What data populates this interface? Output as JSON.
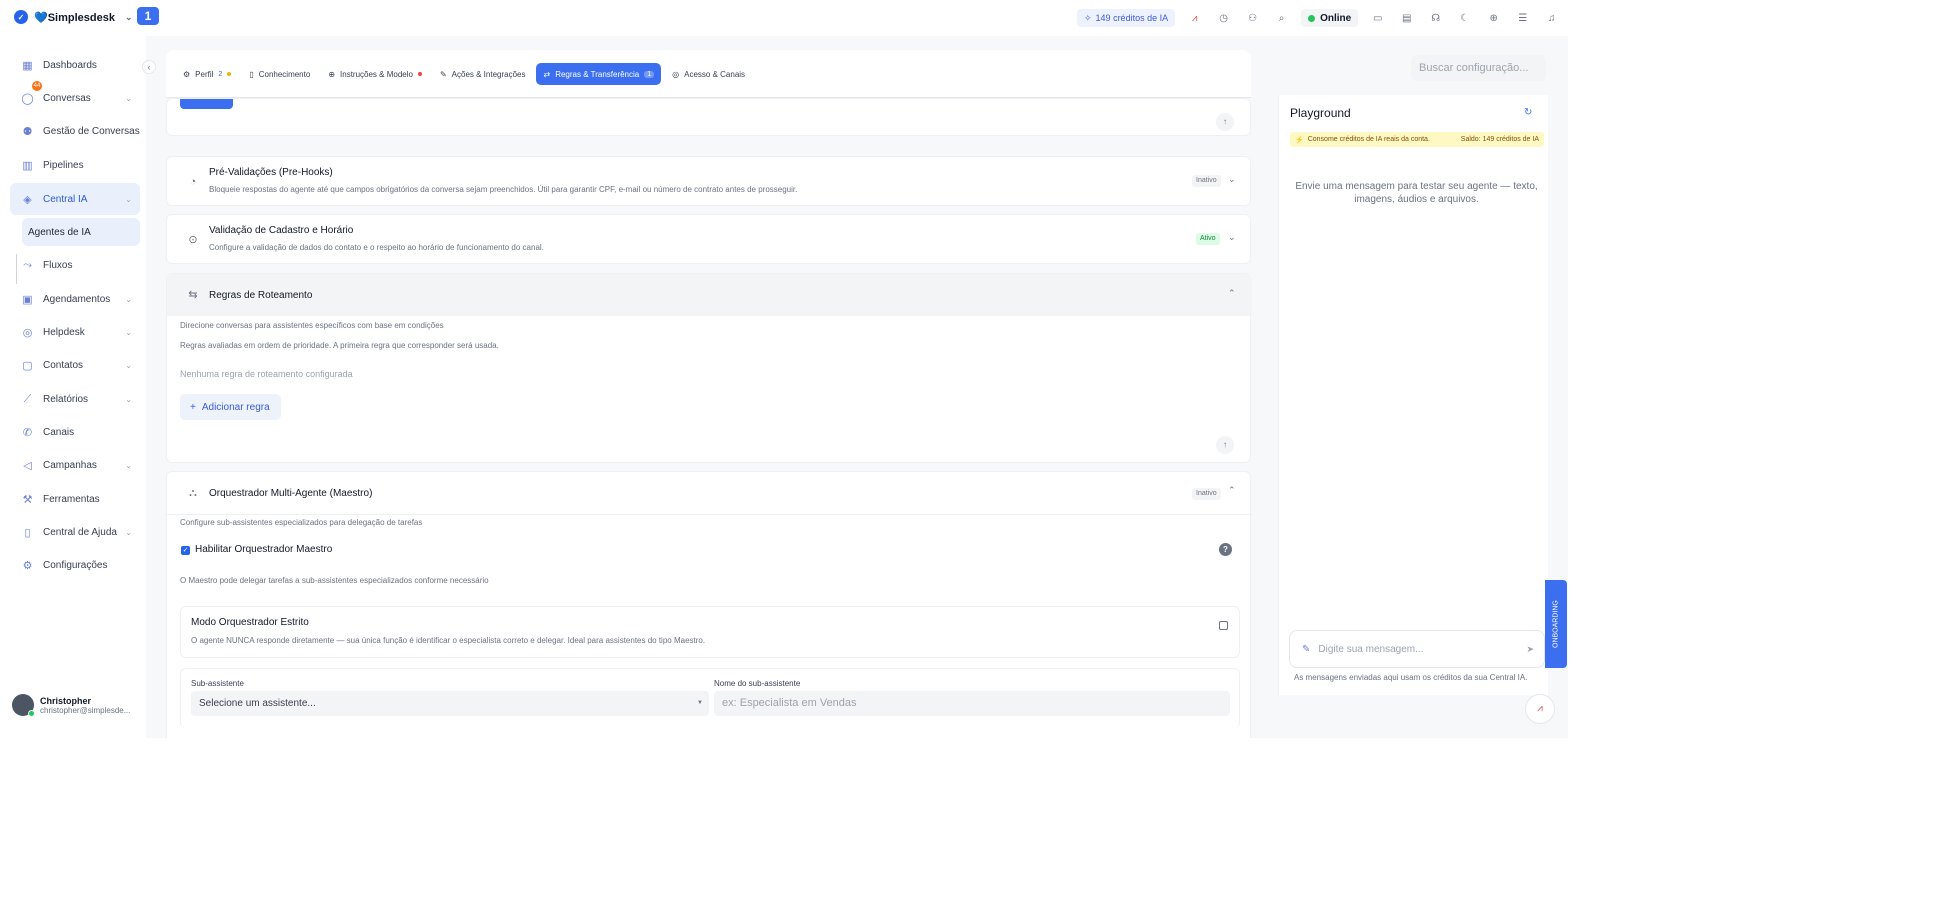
{
  "brand": {
    "name": "💙Simplesdesk",
    "tab_number": "1"
  },
  "topbar": {
    "credits": "149 créditos de IA",
    "status": "Online"
  },
  "sidebar": {
    "items": [
      {
        "label": "Dashboards",
        "icon": "grid-icon"
      },
      {
        "label": "Conversas",
        "icon": "chat-icon",
        "badge": "44"
      },
      {
        "label": "Gestão de Conversas",
        "icon": "people-chat-icon"
      },
      {
        "label": "Pipelines",
        "icon": "kanban-icon"
      },
      {
        "label": "Central IA",
        "icon": "ai-icon"
      },
      {
        "label": "Agentes de IA",
        "icon": ""
      },
      {
        "label": "Fluxos",
        "icon": "flow-icon"
      },
      {
        "label": "Agendamentos",
        "icon": "calendar-icon"
      },
      {
        "label": "Helpdesk",
        "icon": "lifebuoy-icon"
      },
      {
        "label": "Contatos",
        "icon": "contacts-icon"
      },
      {
        "label": "Relatórios",
        "icon": "chart-icon"
      },
      {
        "label": "Canais",
        "icon": "phone-icon"
      },
      {
        "label": "Campanhas",
        "icon": "megaphone-icon"
      },
      {
        "label": "Ferramentas",
        "icon": "tools-icon"
      },
      {
        "label": "Central de Ajuda",
        "icon": "book-icon"
      },
      {
        "label": "Configurações",
        "icon": "gear-icon"
      }
    ],
    "user": {
      "name": "Christopher",
      "email": "christopher@simplesde..."
    }
  },
  "tabs": [
    {
      "label": "Perfil",
      "count": "2"
    },
    {
      "label": "Conhecimento"
    },
    {
      "label": "Instruções & Modelo"
    },
    {
      "label": "Ações & Integrações"
    },
    {
      "label": "Regras & Transferência",
      "count": "1"
    },
    {
      "label": "Acesso & Canais"
    }
  ],
  "search": {
    "placeholder": "Buscar configuração..."
  },
  "sections": {
    "prehooks": {
      "title": "Pré-Validações (Pre-Hooks)",
      "desc": "Bloqueie respostas do agente até que campos obrigatórios da conversa sejam preenchidos. Útil para garantir CPF, e-mail ou número de contrato antes de prosseguir.",
      "state": "Inativo"
    },
    "validation": {
      "title": "Validação de Cadastro e Horário",
      "desc": "Configure a validação de dados do contato e o respeito ao horário de funcionamento do canal.",
      "state": "Ativo"
    },
    "routing": {
      "title": "Regras de Roteamento",
      "desc1": "Direcione conversas para assistentes específicos com base em condições",
      "desc2": "Regras avaliadas em ordem de prioridade. A primeira regra que corresponder será usada.",
      "empty": "Nenhuma regra de roteamento configurada",
      "add_button": "Adicionar regra"
    },
    "maestro": {
      "title": "Orquestrador Multi-Agente (Maestro)",
      "state": "Inativo",
      "desc": "Configure sub-assistentes especializados para delegação de tarefas",
      "enable_label": "Habilitar Orquestrador Maestro",
      "enable_help": "O Maestro pode delegar tarefas a sub-assistentes especializados conforme necessário",
      "strict_title": "Modo Orquestrador Estrito",
      "strict_desc": "O agente NUNCA responde diretamente — sua única função é identificar o especialista correto e delegar. Ideal para assistentes do tipo Maestro.",
      "sub_label": "Sub-assistente",
      "sub_placeholder": "Selecione um assistente...",
      "name_label": "Nome do sub-assistente",
      "name_placeholder": "ex: Especialista em Vendas"
    }
  },
  "playground": {
    "title": "Playground",
    "warning": "Consome créditos de IA reais da conta.",
    "balance": "Saldo: 149 créditos de IA",
    "empty": "Envie uma mensagem para testar seu agente — texto, imagens, áudios e arquivos.",
    "input_placeholder": "Digite sua mensagem...",
    "footer": "As mensagens enviadas aqui usam os créditos da sua Central IA.",
    "side_tab": "ONBOARDING"
  }
}
